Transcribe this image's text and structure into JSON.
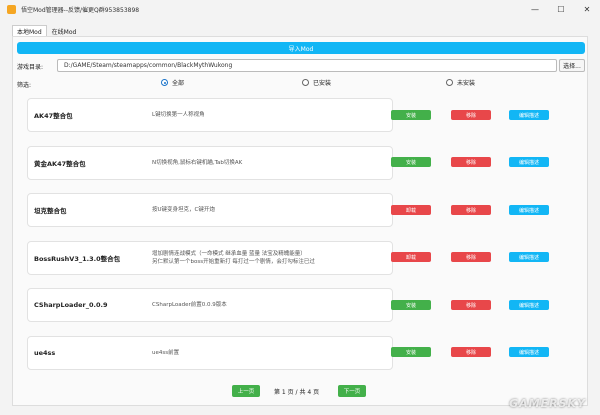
{
  "window": {
    "title": "悟空Mod管理器--反馈/催更Q群953853898",
    "minimize_glyph": "—",
    "maximize_glyph": "☐",
    "close_glyph": "✕"
  },
  "tabs": [
    {
      "label": "本地Mod"
    },
    {
      "label": "在线Mod"
    }
  ],
  "toolbar": {
    "import_label": "导入Mod",
    "game_dir_label": "游戏目录:",
    "game_dir_value": "D:/GAME/Steam/steamapps/common/BlackMythWukong",
    "browse_label": "选择..."
  },
  "filter": {
    "label": "筛选:",
    "options": [
      "全部",
      "已安装",
      "未安装"
    ],
    "selected": "全部"
  },
  "mods": [
    {
      "name": "AK47整合包",
      "description": "L键切换第一人称视角",
      "install_label": "安装",
      "remove_label": "移除",
      "edit_label": "编辑描述"
    },
    {
      "name": "黄金AK47整合包",
      "description": "N切换视角,鼠标右键机瞄,Tab切换AK",
      "install_label": "安装",
      "remove_label": "移除",
      "edit_label": "编辑描述"
    },
    {
      "name": "坦克整合包",
      "description": "按U键变身坦克，C键开炮",
      "install_label": "卸载",
      "remove_label": "移除",
      "edit_label": "编辑描述"
    },
    {
      "name": "BossRushV3_1.3.0整合包",
      "description": "增加剧情连战模式（一命模式 继承血量 蓝量 法宝及精魄能量）\n另仁默认第一个boss开始重新打 每打过一个剧情，会打勾标注已过",
      "install_label": "卸载",
      "remove_label": "移除",
      "edit_label": "编辑描述"
    },
    {
      "name": "CSharpLoader_0.0.9",
      "description": "CSharpLoader前置0.0.9版本",
      "install_label": "安装",
      "remove_label": "移除",
      "edit_label": "编辑描述"
    },
    {
      "name": "ue4ss",
      "description": "ue4ss前置",
      "install_label": "安装",
      "remove_label": "移除",
      "edit_label": "编辑描述"
    }
  ],
  "pagination": {
    "prev_label": "上一页",
    "next_label": "下一页",
    "info": "第 1 页 / 共 4 页"
  },
  "watermark": "GAMERSKY",
  "colors": {
    "accent_blue": "#12b6f5",
    "install_green": "#43b04a",
    "remove_red": "#e8474a",
    "app_icon": "#f5a623"
  }
}
